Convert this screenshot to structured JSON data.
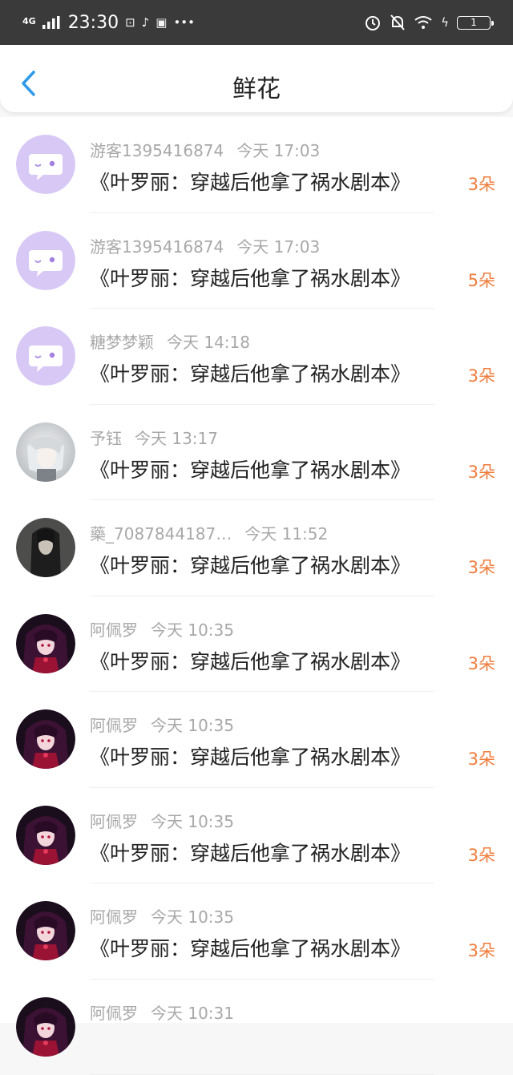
{
  "status_bar": {
    "network": "4G",
    "time": "23:30",
    "battery": "1"
  },
  "header": {
    "title": "鲜花"
  },
  "accent_color": "#f07c3c",
  "rows": [
    {
      "user": "游客1395416874",
      "time": "今天 17:03",
      "book": "《叶罗丽：穿越后他拿了祸水剧本》",
      "amount": "3朵",
      "avatar": "chat-bubble"
    },
    {
      "user": "游客1395416874",
      "time": "今天 17:03",
      "book": "《叶罗丽：穿越后他拿了祸水剧本》",
      "amount": "5朵",
      "avatar": "chat-bubble"
    },
    {
      "user": "糖梦梦颖",
      "time": "今天 14:18",
      "book": "《叶罗丽：穿越后他拿了祸水剧本》",
      "amount": "3朵",
      "avatar": "chat-bubble"
    },
    {
      "user": "予钰",
      "time": "今天 13:17",
      "book": "《叶罗丽：穿越后他拿了祸水剧本》",
      "amount": "3朵",
      "avatar": "photo-light"
    },
    {
      "user": "藥_7087844187…",
      "time": "今天 11:52",
      "book": "《叶罗丽：穿越后他拿了祸水剧本》",
      "amount": "3朵",
      "avatar": "photo-dark"
    },
    {
      "user": "阿佩罗",
      "time": "今天 10:35",
      "book": "《叶罗丽：穿越后他拿了祸水剧本》",
      "amount": "3朵",
      "avatar": "photo-red"
    },
    {
      "user": "阿佩罗",
      "time": "今天 10:35",
      "book": "《叶罗丽：穿越后他拿了祸水剧本》",
      "amount": "3朵",
      "avatar": "photo-red"
    },
    {
      "user": "阿佩罗",
      "time": "今天 10:35",
      "book": "《叶罗丽：穿越后他拿了祸水剧本》",
      "amount": "3朵",
      "avatar": "photo-red"
    },
    {
      "user": "阿佩罗",
      "time": "今天 10:35",
      "book": "《叶罗丽：穿越后他拿了祸水剧本》",
      "amount": "3朵",
      "avatar": "photo-red"
    },
    {
      "user": "阿佩罗",
      "time": "今天 10:31",
      "book": "",
      "amount": "",
      "avatar": "photo-red"
    }
  ]
}
